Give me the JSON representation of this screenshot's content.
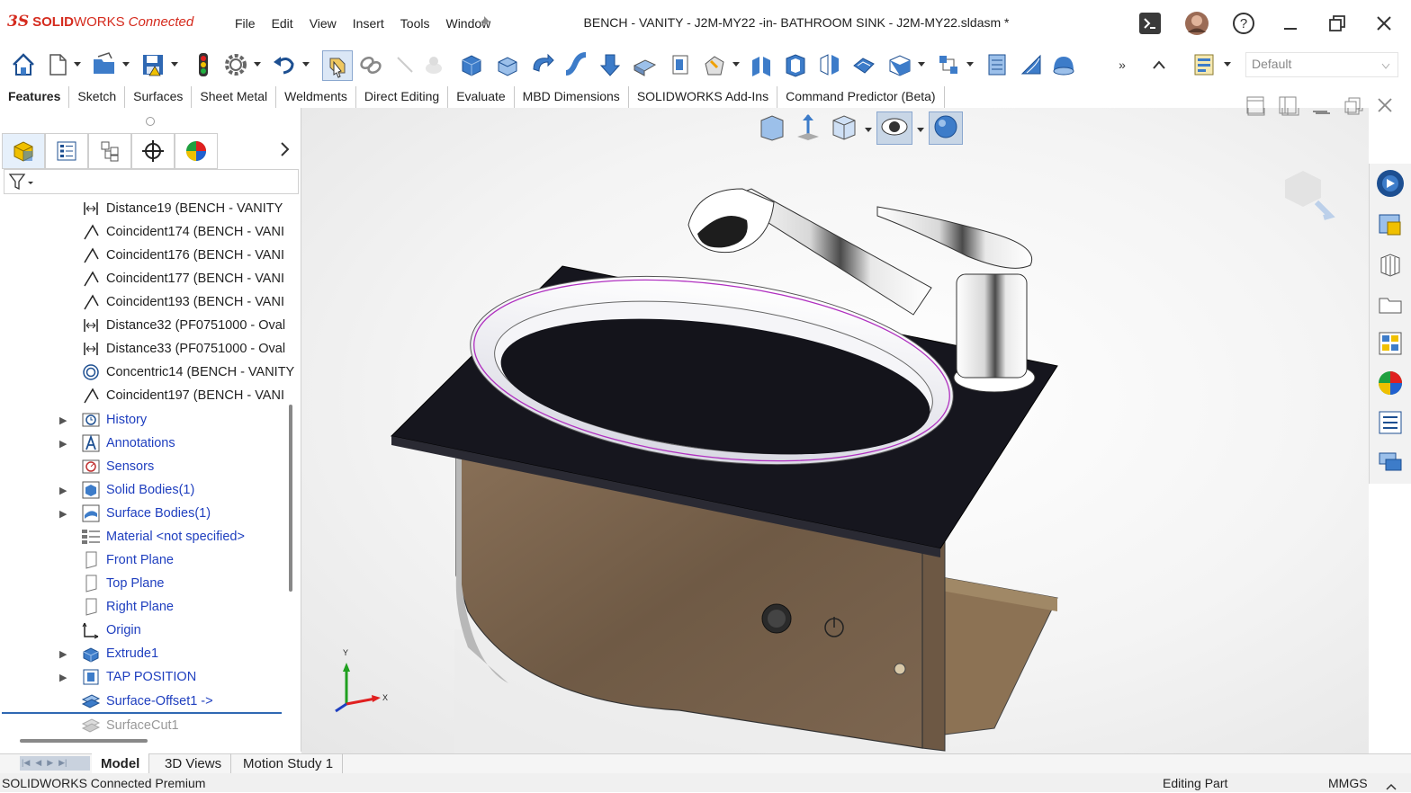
{
  "app": {
    "logo_ds": "3S",
    "logo_solid": "SOLID",
    "logo_works": "WORKS",
    "logo_connected": "Connected",
    "document_title": "BENCH - VANITY  - J2M-MY22 -in- BATHROOM SINK - J2M-MY22.sldasm *"
  },
  "menu": [
    "File",
    "Edit",
    "View",
    "Insert",
    "Tools",
    "Window"
  ],
  "toolbar": {
    "config_placeholder": "Default"
  },
  "tabs": [
    "Features",
    "Sketch",
    "Surfaces",
    "Sheet Metal",
    "Weldments",
    "Direct Editing",
    "Evaluate",
    "MBD Dimensions",
    "SOLIDWORKS Add-Ins",
    "Command Predictor (Beta)"
  ],
  "tree": [
    {
      "label": "Distance19 (BENCH - VANITY",
      "icon": "distance-mate-icon",
      "kind": "mate"
    },
    {
      "label": "Coincident174 (BENCH - VANI",
      "icon": "coincident-mate-icon",
      "kind": "mate"
    },
    {
      "label": "Coincident176 (BENCH - VANI",
      "icon": "coincident-mate-icon",
      "kind": "mate"
    },
    {
      "label": "Coincident177 (BENCH - VANI",
      "icon": "coincident-mate-icon",
      "kind": "mate"
    },
    {
      "label": "Coincident193 (BENCH - VANI",
      "icon": "coincident-mate-icon",
      "kind": "mate"
    },
    {
      "label": "Distance32 (PF0751000 - Oval",
      "icon": "distance-mate-icon",
      "kind": "mate"
    },
    {
      "label": "Distance33 (PF0751000 - Oval",
      "icon": "distance-mate-icon",
      "kind": "mate"
    },
    {
      "label": "Concentric14 (BENCH - VANITY",
      "icon": "concentric-mate-icon",
      "kind": "mate"
    },
    {
      "label": "Coincident197 (BENCH - VANI",
      "icon": "coincident-mate-icon",
      "kind": "mate"
    },
    {
      "label": "History",
      "icon": "history-icon",
      "kind": "feat",
      "expand": true
    },
    {
      "label": "Annotations",
      "icon": "annotations-icon",
      "kind": "feat",
      "expand": true
    },
    {
      "label": "Sensors",
      "icon": "sensors-icon",
      "kind": "feat"
    },
    {
      "label": "Solid Bodies(1)",
      "icon": "solid-bodies-icon",
      "kind": "feat",
      "expand": true
    },
    {
      "label": "Surface Bodies(1)",
      "icon": "surface-bodies-icon",
      "kind": "feat",
      "expand": true
    },
    {
      "label": "Material <not specified>",
      "icon": "material-icon",
      "kind": "feat"
    },
    {
      "label": "Front Plane",
      "icon": "plane-icon",
      "kind": "feat"
    },
    {
      "label": "Top Plane",
      "icon": "plane-icon",
      "kind": "feat"
    },
    {
      "label": "Right Plane",
      "icon": "plane-icon",
      "kind": "feat"
    },
    {
      "label": "Origin",
      "icon": "origin-icon",
      "kind": "feat"
    },
    {
      "label": "Extrude1",
      "icon": "extrude-icon",
      "kind": "feat",
      "expand": true
    },
    {
      "label": "TAP POSITION",
      "icon": "part-feature-icon",
      "kind": "feat",
      "expand": true
    },
    {
      "label": "Surface-Offset1 ->",
      "icon": "surface-offset-icon",
      "kind": "feat"
    },
    {
      "label": "SurfaceCut1",
      "icon": "surface-cut-icon",
      "kind": "grey"
    }
  ],
  "triad": {
    "y": "Y",
    "x": "X"
  },
  "bottom_tabs": [
    "Model",
    "3D Views",
    "Motion Study 1"
  ],
  "status": {
    "left": "SOLIDWORKS Connected Premium",
    "mode": "Editing Part",
    "units": "MMGS"
  },
  "colors": {
    "brand": "#d52b1e",
    "feature_text": "#1f3fbf",
    "accent_blue": "#2f7bd6"
  }
}
